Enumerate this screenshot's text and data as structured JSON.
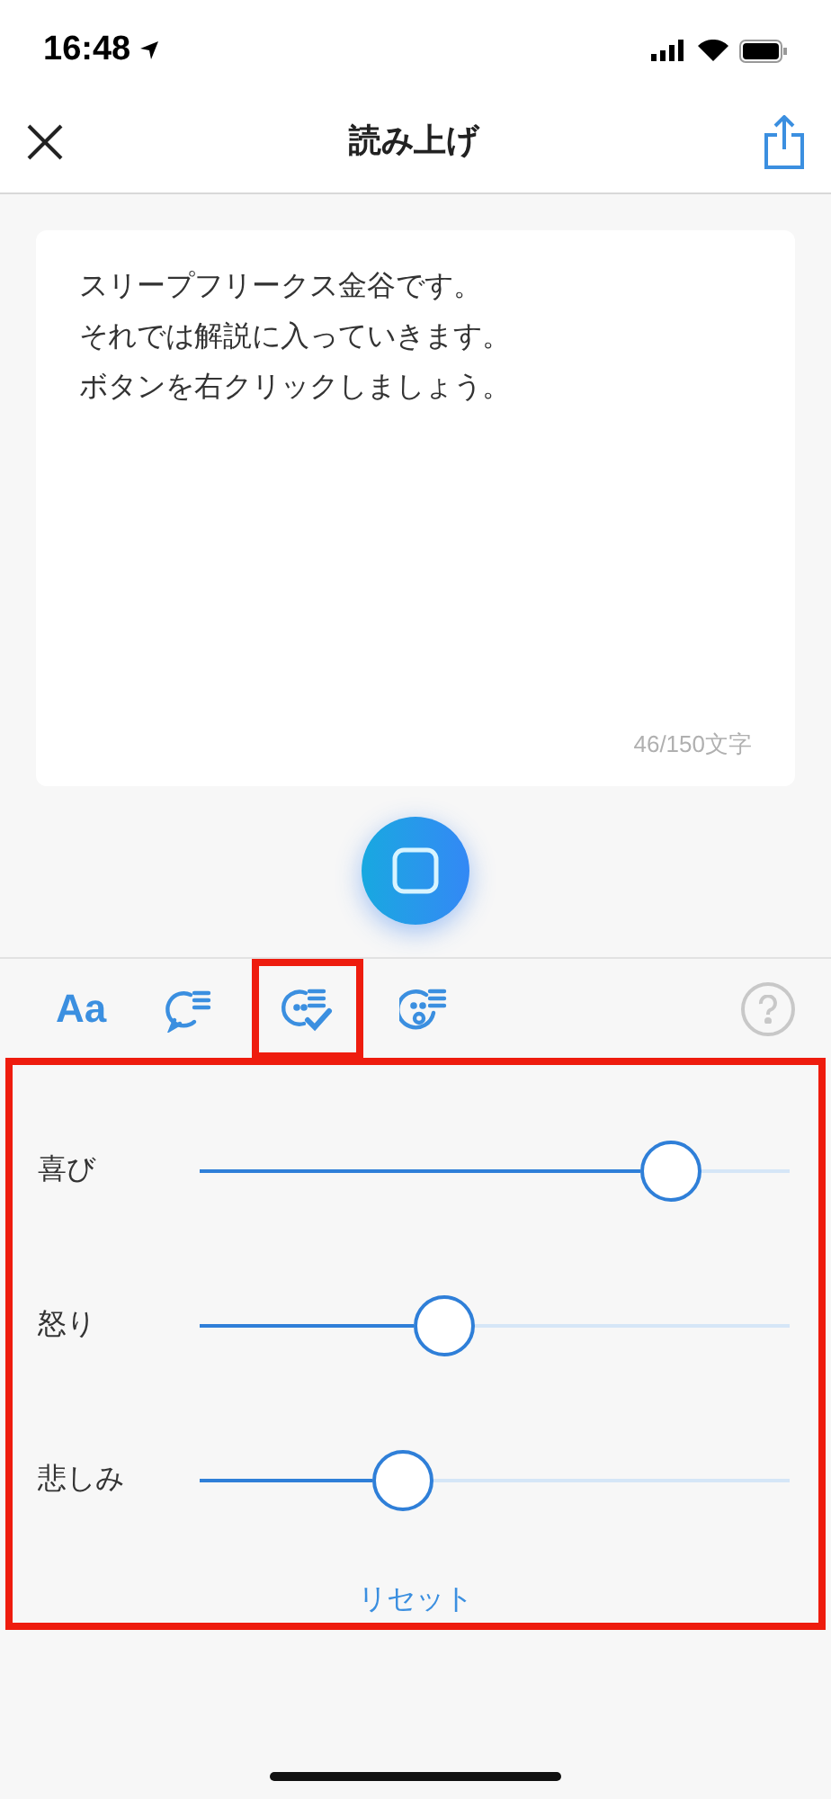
{
  "status_bar": {
    "time": "16:48"
  },
  "nav": {
    "title": "読み上げ"
  },
  "text_input": {
    "lines": [
      "スリープフリークス金谷です。",
      "それでは解説に入っていきます。",
      "ボタンを右クリックしましょう。"
    ],
    "counter": "46/150文字"
  },
  "tabs": [
    {
      "kind": "font",
      "label": "Aa",
      "selected": false
    },
    {
      "kind": "speech",
      "selected": false
    },
    {
      "kind": "emotion",
      "selected": true
    },
    {
      "kind": "surprise",
      "selected": false
    }
  ],
  "panel": {
    "highlighted": true,
    "sliders": [
      {
        "label": "喜び",
        "level": 0.8
      },
      {
        "label": "怒り",
        "level": 0.415
      },
      {
        "label": "悲しみ",
        "level": 0.346
      }
    ],
    "reset": "リセット"
  }
}
